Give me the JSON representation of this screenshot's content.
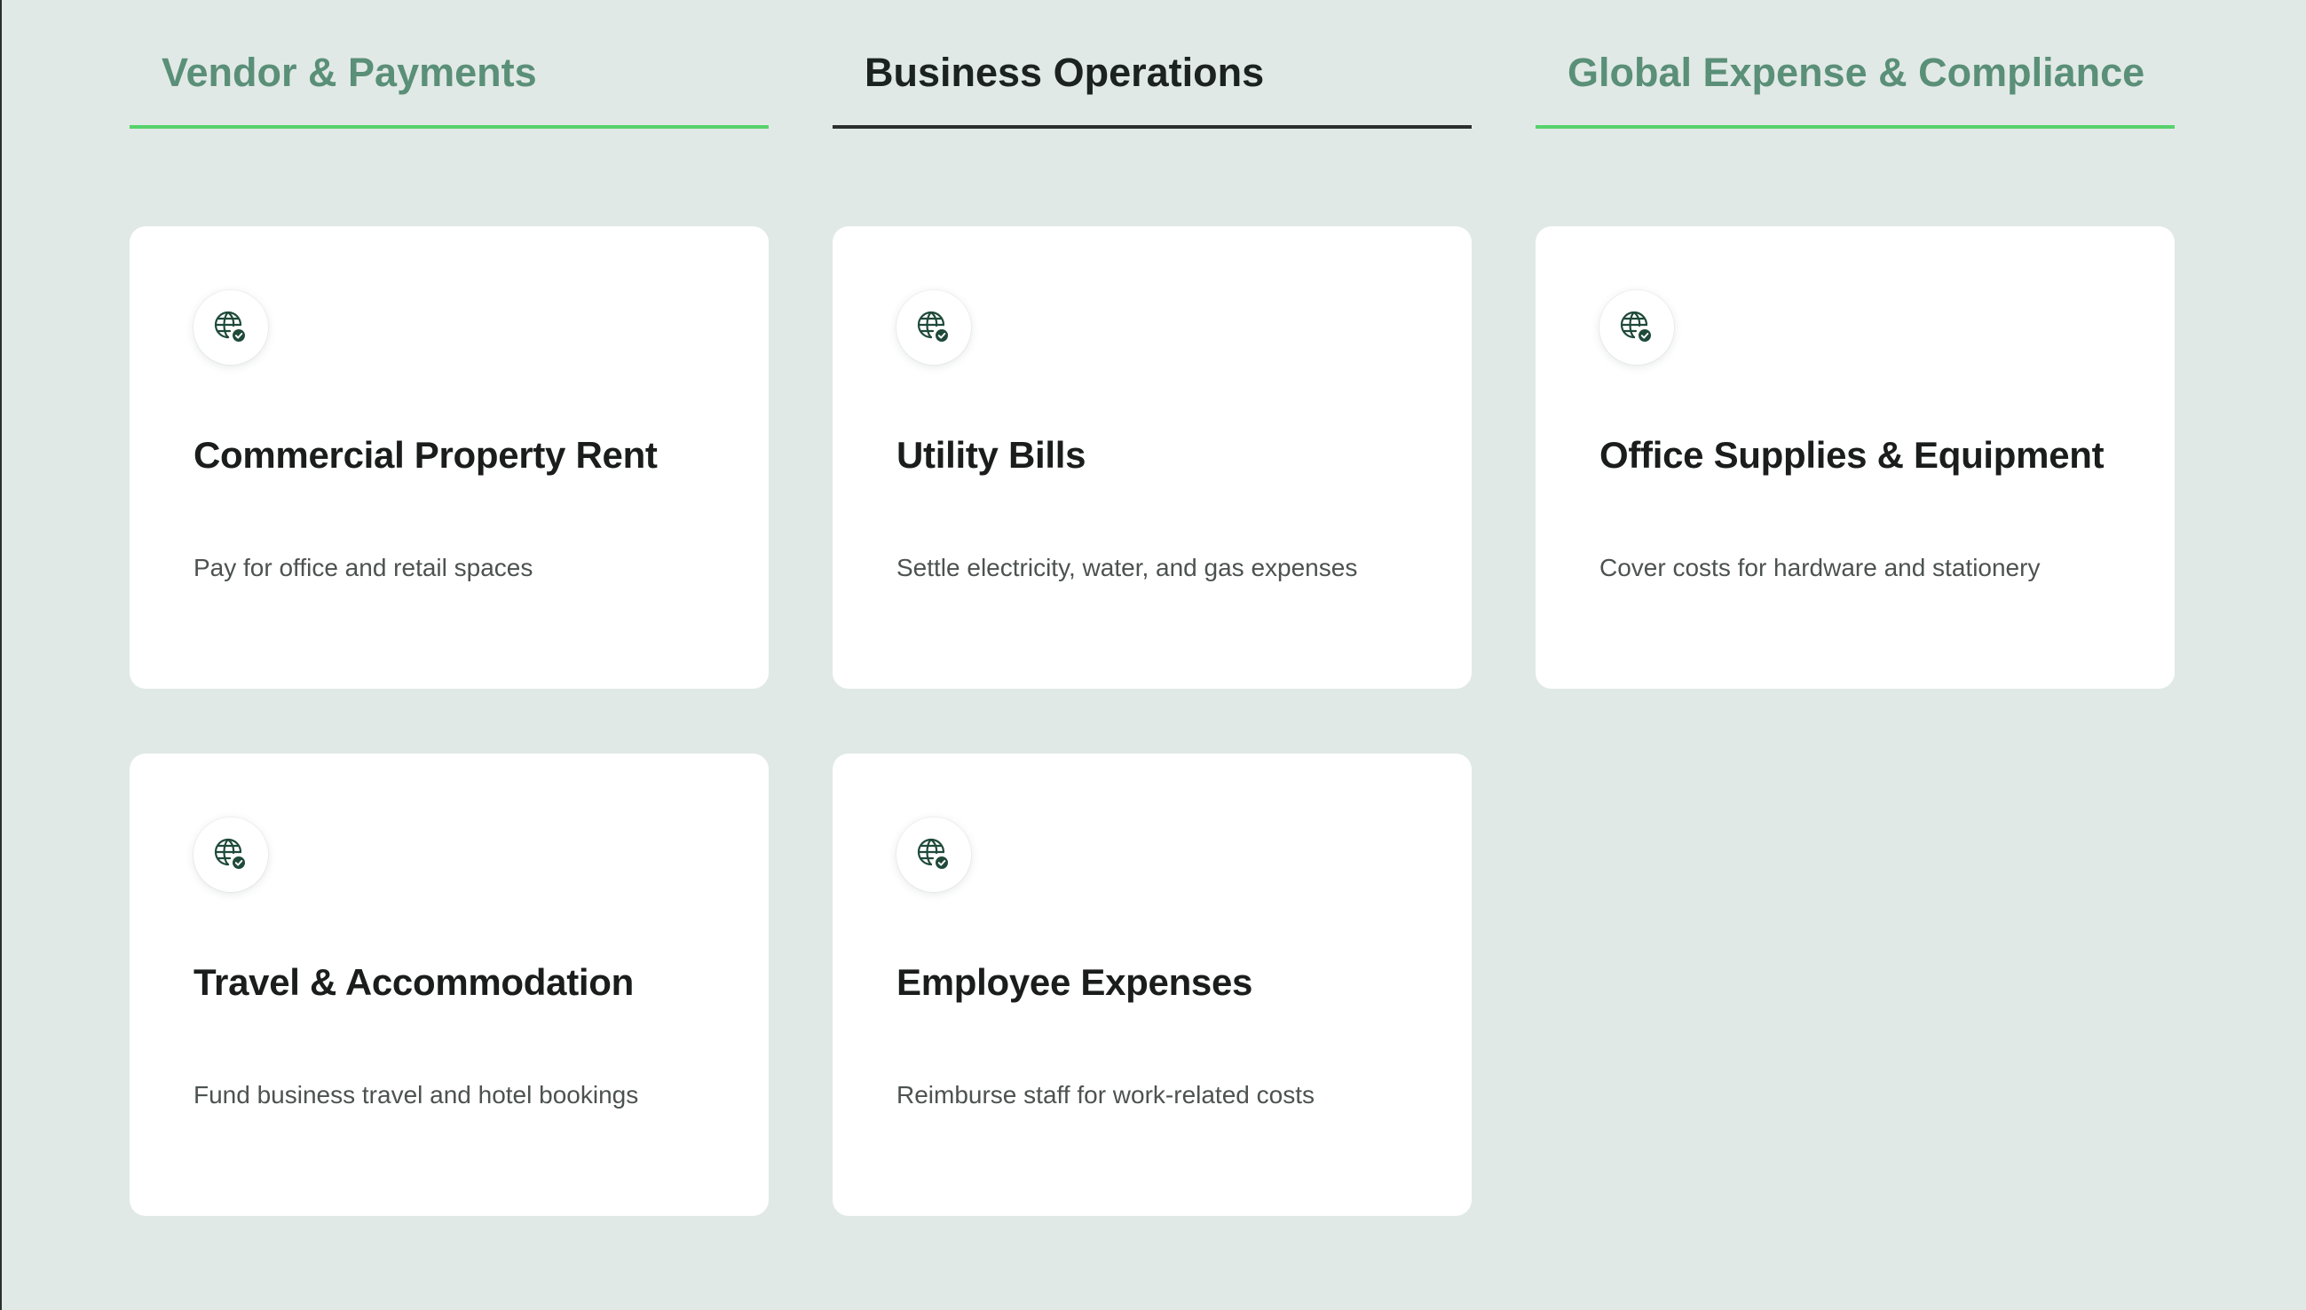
{
  "tabs": [
    {
      "label": "Vendor & Payments",
      "active": false
    },
    {
      "label": "Business Operations",
      "active": true
    },
    {
      "label": "Global Expense & Compliance",
      "active": false
    }
  ],
  "cards": [
    {
      "title": "Commercial Property Rent",
      "description": "Pay for office and retail spaces",
      "icon": "globe-check-icon"
    },
    {
      "title": "Utility Bills",
      "description": "Settle electricity, water, and gas expenses",
      "icon": "globe-check-icon"
    },
    {
      "title": "Office Supplies & Equipment",
      "description": "Cover costs for hardware and stationery",
      "icon": "globe-check-icon"
    },
    {
      "title": "Travel & Accommodation",
      "description": "Fund business travel and hotel bookings",
      "icon": "globe-check-icon"
    },
    {
      "title": "Employee Expenses",
      "description": "Reimburse staff for work-related costs",
      "icon": "globe-check-icon"
    }
  ],
  "colors": {
    "background": "#e1e9e6",
    "tab_inactive_text": "#5a8f78",
    "tab_inactive_underline": "#56d26c",
    "tab_active_text": "#1c2220",
    "tab_active_underline": "#2b302e",
    "icon": "#1f4a3a"
  }
}
